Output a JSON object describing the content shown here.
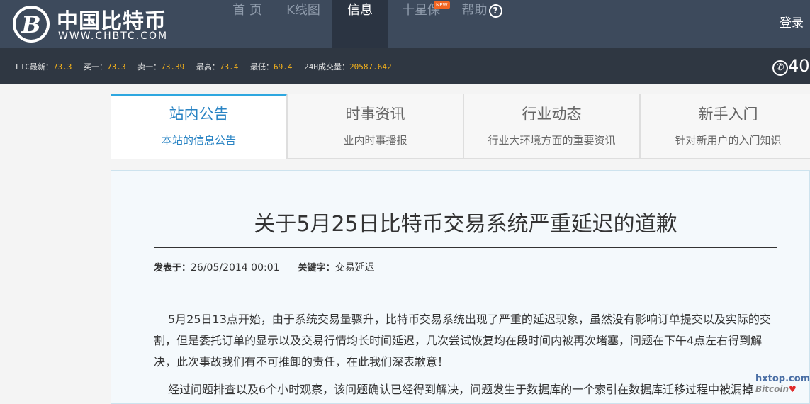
{
  "header": {
    "logo_cn": "中国比特币",
    "logo_en": "WWW.CHBTC.COM",
    "logo_letter": "B",
    "nav": {
      "home": "首 页",
      "kline": "K线图",
      "info": "信息",
      "ten_star": "十星保",
      "ten_star_badge": "NEW",
      "help": "帮助",
      "help_icon": "?"
    },
    "login": "登录"
  },
  "ticker": {
    "items": [
      {
        "label": "LTC最新：",
        "value": "73.3"
      },
      {
        "label": "买一：",
        "value": "73.3"
      },
      {
        "label": "卖一：",
        "value": "73.39"
      },
      {
        "label": "最高：",
        "value": "73.4"
      },
      {
        "label": "最低：",
        "value": "69.4"
      },
      {
        "label": "24H成交量：",
        "value": "20587.642"
      }
    ],
    "phone_prefix": "40"
  },
  "tabs": [
    {
      "title": "站内公告",
      "sub": "本站的信息公告"
    },
    {
      "title": "时事资讯",
      "sub": "业内时事播报"
    },
    {
      "title": "行业动态",
      "sub": "行业大环境方面的重要资讯"
    },
    {
      "title": "新手入门",
      "sub": "针对新用户的入门知识"
    }
  ],
  "article": {
    "title": "关于5月25日比特币交易系统严重延迟的道歉",
    "posted_label": "发表于：",
    "posted_value": "26/05/2014 00:01",
    "keyword_label": "关键字：",
    "keyword_value": "交易延迟",
    "paragraphs": [
      "5月25日13点开始，由于系统交易量骤升，比特币交易系统出现了严重的延迟现象，虽然没有影响订单提交以及实际的交割，但是委托订单的显示以及交易行情均长时间延迟，几次尝试恢复均在段时间内被再次堵塞，问题在下午4点左右得到解决，此次事故我们有不可推卸的责任，在此我们深表歉意！",
      "经过问题排查以及6个小时观察，该问题确认已经得到解决，问题发生于数据库的一个索引在数据库迁移过程中被漏掉"
    ]
  },
  "watermark": {
    "site": "hxtop.com",
    "sub": "Bitcoin"
  },
  "colors": {
    "header_bg": "#3d4a5c",
    "ticker_bg": "#2f3742",
    "accent": "#2ea7e0",
    "ticker_value": "#f5b21b"
  }
}
